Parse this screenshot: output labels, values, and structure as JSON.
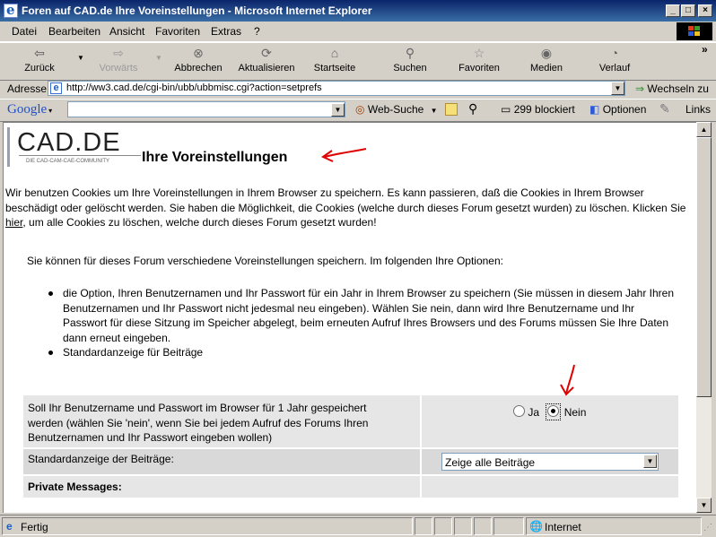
{
  "window": {
    "title": "Foren auf CAD.de Ihre Voreinstellungen - Microsoft Internet Explorer"
  },
  "menu": [
    "Datei",
    "Bearbeiten",
    "Ansicht",
    "Favoriten",
    "Extras",
    "?"
  ],
  "toolbar": {
    "back": "Zurück",
    "forward": "Vorwärts",
    "stop": "Abbrechen",
    "refresh": "Aktualisieren",
    "home": "Startseite",
    "search": "Suchen",
    "favorites": "Favoriten",
    "media": "Medien",
    "history": "Verlauf",
    "more": "»"
  },
  "address": {
    "label": "Adresse",
    "url": "http://ww3.cad.de/cgi-bin/ubb/ubbmisc.cgi?action=setprefs",
    "go": "Wechseln zu"
  },
  "google": {
    "logo": "Google",
    "web_search": "Web-Suche",
    "blocked": "299 blockiert",
    "options": "Optionen",
    "links": "Links"
  },
  "page": {
    "logo_text": "CAD.DE",
    "logo_sub": "DIE CAD-CAM-CAE-COMMUNITY",
    "heading": "Ihre Voreinstellungen",
    "intro_1": "Wir benutzen Cookies um Ihre Voreinstellungen in Ihrem Browser zu speichern. Es kann passieren, daß die Cookies in Ihrem Browser beschädigt oder gelöscht werden. Sie haben die Möglichkeit, die Cookies (welche durch dieses Forum gesetzt wurden) zu löschen. Klicken Sie ",
    "intro_link": "hier",
    "intro_2": ", um alle Cookies zu löschen, welche durch dieses Forum gesetzt wurden!",
    "options_intro": "Sie können für dieses Forum verschiedene Voreinstellungen speichern. Im folgenden Ihre Optionen:",
    "bullets": [
      "die Option, Ihren Benutzernamen und Ihr Passwort für ein Jahr in Ihrem Browser zu speichern (Sie müssen in diesem Jahr Ihren Benutzernamen und Ihr Passwort nicht jedesmal neu eingeben). Wählen Sie nein, dann wird Ihre Benutzername und Ihr Passwort für diese Sitzung im Speicher abgelegt, beim erneuten Aufruf Ihres Browsers und des Forums müssen Sie Ihre Daten dann erneut eingeben.",
      "Standardanzeige für Beiträge"
    ],
    "row1_label": "Soll Ihr Benutzername und Passwort im Browser für 1 Jahr gespeichert werden (wählen Sie 'nein', wenn Sie bei jedem Aufruf des Forums Ihren Benutzernamen und Ihr Passwort eingeben wollen)",
    "radio_yes": "Ja",
    "radio_no": "Nein",
    "radio_selected": "Nein",
    "row2_label": "Standardanzeige der Beiträge:",
    "row2_select": "Zeige alle Beiträge",
    "row3_label": "Private Messages:"
  },
  "status": {
    "text": "Fertig",
    "zone": "Internet"
  },
  "colors": {
    "titlebar": "#0a246a",
    "annotation_arrow": "#e00000",
    "table_row": "#e6e6e6"
  }
}
